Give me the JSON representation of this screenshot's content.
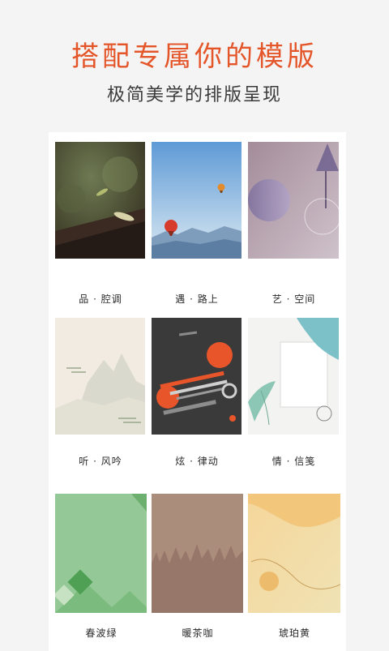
{
  "header": {
    "title": "搭配专属你的模版",
    "subtitle": "极简美学的排版呈现"
  },
  "templates": [
    {
      "label": "品 · 腔调"
    },
    {
      "label": "遇 · 路上"
    },
    {
      "label": "艺 · 空间"
    },
    {
      "label": "听 · 风吟"
    },
    {
      "label": "炫 · 律动"
    },
    {
      "label": "情 · 信笺"
    },
    {
      "label": "春波绿"
    },
    {
      "label": "暖茶咖"
    },
    {
      "label": "琥珀黄"
    }
  ],
  "colors": {
    "accent": "#e4562a",
    "subtitle": "#3a3a3a",
    "background": "#f4f4f4",
    "panel": "#ffffff"
  }
}
